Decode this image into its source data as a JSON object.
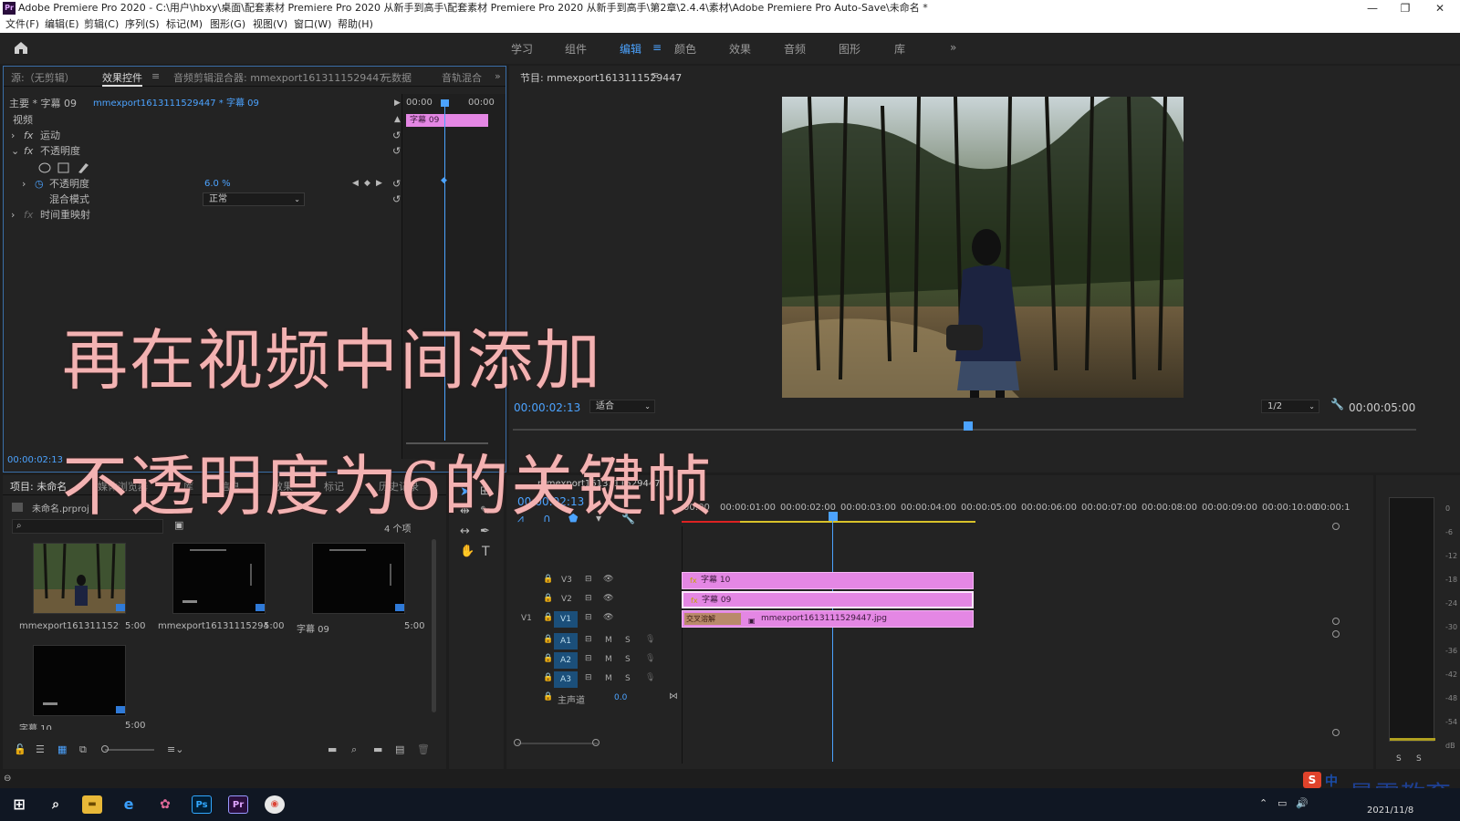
{
  "window": {
    "title": "Adobe Premiere Pro 2020 - C:\\用户\\hbxy\\桌面\\配套素材 Premiere Pro 2020 从新手到高手\\配套素材 Premiere Pro 2020 从新手到高手\\第2章\\2.4.4\\素材\\Adobe Premiere Pro Auto-Save\\未命名 *",
    "logo": "Pr",
    "minimize": "—",
    "restore": "❐",
    "close": "✕"
  },
  "menu": [
    "文件(F)",
    "编辑(E)",
    "剪辑(C)",
    "序列(S)",
    "标记(M)",
    "图形(G)",
    "视图(V)",
    "窗口(W)",
    "帮助(H)"
  ],
  "workspaces": {
    "tabs": [
      "学习",
      "组件",
      "编辑",
      "颜色",
      "效果",
      "音频",
      "图形",
      "库"
    ],
    "active_index": 2,
    "more": "»"
  },
  "source_panel": {
    "tabs": [
      "源:（无剪辑）",
      "效果控件",
      "音频剪辑混合器: mmexport1613111529447",
      "元数据",
      "音轨混合"
    ],
    "active_index": 1,
    "master_label": "主要 * 字幕 09",
    "clip_label": "mmexport1613111529447 * 字幕 09",
    "ruler_start": "00:00",
    "ruler_end": "00:00",
    "mini_clip": "字幕 09",
    "section_video": "视频",
    "fx_motion": "运动",
    "fx_opacity": "不透明度",
    "opacity_param": "不透明度",
    "opacity_value": "6.0 %",
    "blend_label": "混合模式",
    "blend_value": "正常",
    "time_remap": "时间重映射",
    "timecode": "00:00:02:13"
  },
  "program_monitor": {
    "title": "节目: mmexport1613111529447",
    "timecode": "00:00:02:13",
    "fit": "适合",
    "resolution": "1/2",
    "duration": "00:00:05:00"
  },
  "project_panel": {
    "tabs": [
      "项目: 未命名",
      "媒体浏览器",
      "库",
      "信息",
      "效果",
      "标记",
      "历史记录"
    ],
    "project_file": "未命名.prproj",
    "item_count": "4 个项",
    "items": [
      {
        "name": "mmexport1613111529447_",
        "duration": "5:00"
      },
      {
        "name": "mmexport1613111529447",
        "duration": "5:00"
      },
      {
        "name": "字幕 09",
        "duration": "5:00"
      },
      {
        "name": "字幕 10",
        "duration": "5:00"
      }
    ]
  },
  "timeline": {
    "sequence": "mmexport1613111529447",
    "timecode": "00:00:02:13",
    "ruler": [
      "00:00",
      "00:00:01:00",
      "00:00:02:00",
      "00:00:03:00",
      "00:00:04:00",
      "00:00:05:00",
      "00:00:06:00",
      "00:00:07:00",
      "00:00:08:00",
      "00:00:09:00",
      "00:00:10:00",
      "00:00:1"
    ],
    "video_tracks": [
      "V3",
      "V2",
      "V1"
    ],
    "audio_tracks": [
      "A1",
      "A2",
      "A3"
    ],
    "master_label": "主声道",
    "master_value": "0.0",
    "clips": {
      "v3": "字幕 10",
      "v2": "字幕 09",
      "v1_transition": "交叉溶解",
      "v1": "mmexport1613111529447.jpg"
    },
    "meter_labels": [
      "0",
      "-6",
      "-12",
      "-18",
      "-24",
      "-30",
      "-36",
      "-42",
      "-48",
      "-54",
      "dB"
    ],
    "solo": [
      "S",
      "S"
    ]
  },
  "overlay": {
    "line1": "再在视频中间添加",
    "line2": "不透明度为6的关键帧"
  },
  "watermark": "最需教育",
  "ime": "中",
  "taskbar": {
    "apps": [
      "Ps",
      "Pr"
    ],
    "date": "2021/11/8"
  },
  "colors": {
    "clip": "#e487e4",
    "accent": "#4ca3ff",
    "overlay_text": "#f3b2b2"
  }
}
